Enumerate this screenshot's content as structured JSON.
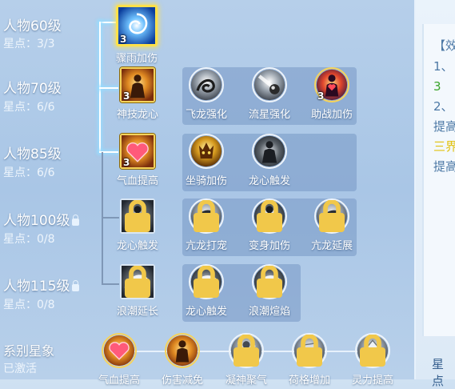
{
  "tiers": [
    {
      "label": "人物60级",
      "sub": "星点：3/3",
      "locked": false
    },
    {
      "label": "人物70级",
      "sub": "星点：6/6",
      "locked": false
    },
    {
      "label": "人物85级",
      "sub": "星点：6/6",
      "locked": false
    },
    {
      "label": "人物100级",
      "sub": "星点：0/8",
      "locked": true
    },
    {
      "label": "人物115级",
      "sub": "星点：0/8",
      "locked": true
    }
  ],
  "skills": {
    "r1": [
      {
        "name": "骤雨加伤",
        "count": "3",
        "icon": "swirl-icon"
      }
    ],
    "r2": [
      {
        "name": "神技龙心",
        "count": "3",
        "icon": "flame-figure-icon"
      },
      {
        "name": "飞龙强化",
        "count": "",
        "icon": "dragon-icon"
      },
      {
        "name": "流星强化",
        "count": "",
        "icon": "meteor-icon"
      },
      {
        "name": "助战加伤",
        "count": "3",
        "icon": "heart-figure-icon"
      }
    ],
    "r3": [
      {
        "name": "气血提高",
        "count": "3",
        "icon": "heart-icon"
      },
      {
        "name": "坐骑加伤",
        "count": "",
        "icon": "demon-icon"
      },
      {
        "name": "龙心触发",
        "count": "",
        "icon": "silhouette-icon"
      }
    ],
    "r4": [
      {
        "name": "龙心触发",
        "icon": "silhouette-icon"
      },
      {
        "name": "亢龙打宠",
        "icon": "dragon-icon"
      },
      {
        "name": "变身加伤",
        "icon": "silhouette-icon"
      },
      {
        "name": "亢龙延展",
        "icon": "dragon-icon"
      }
    ],
    "r5": [
      {
        "name": "浪潮延长",
        "icon": "wave-icon"
      },
      {
        "name": "龙心触发",
        "icon": "wave-icon"
      },
      {
        "name": "浪潮煊焰",
        "icon": "wave-icon"
      }
    ]
  },
  "constellation": {
    "label": "系别星象",
    "status": "已激活",
    "items": [
      {
        "name": "气血提高",
        "icon": "heart-icon"
      },
      {
        "name": "伤害减免",
        "icon": "flame-figure-icon"
      },
      {
        "name": "凝神聚气",
        "icon": "sparkle-icon"
      },
      {
        "name": "荷格增加",
        "icon": "rock-icon"
      },
      {
        "name": "灵力提高",
        "icon": "crystal-icon"
      }
    ]
  },
  "side": {
    "lines": [
      "【效",
      "1、",
      "3",
      "2、",
      "提高",
      "三界",
      "提高"
    ],
    "bottom": "星点"
  },
  "colors": {
    "side_dark": "#4c78a5",
    "side_green": "#3aa42a",
    "side_yellow": "#e2c20f"
  }
}
